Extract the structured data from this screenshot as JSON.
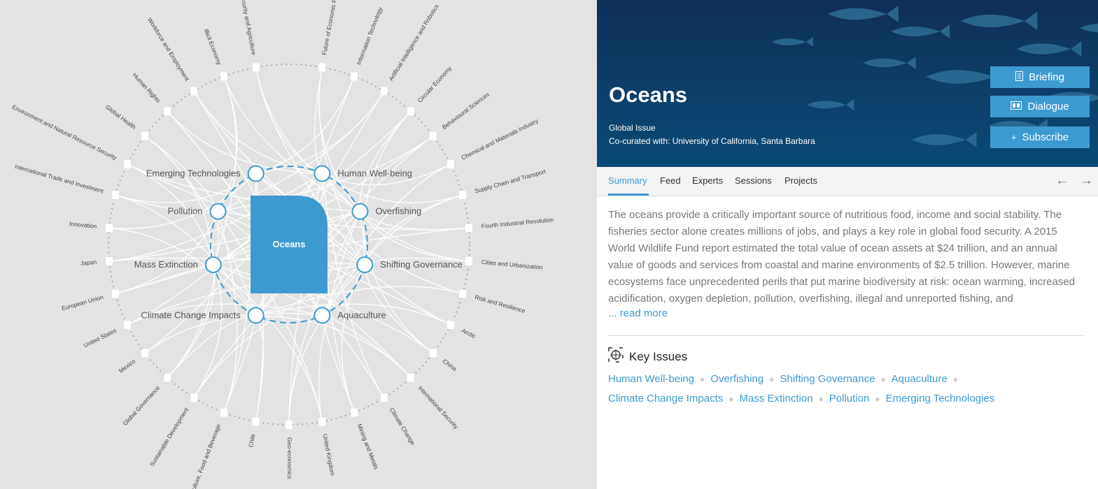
{
  "graph": {
    "center_label": "Oceans",
    "key_issues": [
      "Human Well-being",
      "Overfishing",
      "Shifting Governance",
      "Aquaculture",
      "Climate Change Impacts",
      "Mass Extinction",
      "Pollution",
      "Emerging Technologies"
    ],
    "outer_topics": [
      "Food Security and Agriculture",
      "Illicit Economy",
      "Workforce and Employment",
      "Human Rights",
      "Global Health",
      "Environment and Natural Resource Security",
      "International Trade and Investment",
      "Innovation",
      "Japan",
      "European Union",
      "United States",
      "Mexico",
      "Global Governance",
      "Sustainable Development",
      "Agriculture, Food and Beverage",
      "Chile",
      "Geo-economics",
      "United Kingdom",
      "Mining and Metals",
      "Climate Change",
      "International Security",
      "China",
      "Arctic",
      "Risk and Resilience",
      "Cities and Urbanization",
      "Fourth Industrial Revolution",
      "Supply Chain and Transport",
      "Chemical and Materials Industry",
      "Behavioural Sciences",
      "Circular Economy",
      "Artificial Intelligence and Robotics",
      "Information Technology",
      "Future of Economic Progress"
    ],
    "colors": {
      "accent": "#3d9ad1",
      "background": "#e3e3e3",
      "links": "#ffffff",
      "ring": "#aaaaaa"
    }
  },
  "hero": {
    "title": "Oceans",
    "type": "Global Issue",
    "cocurated": "Co-curated with: University of California, Santa Barbara",
    "buttons": {
      "briefing": "Briefing",
      "dialogue": "Dialogue",
      "subscribe": "Subscribe"
    }
  },
  "tabs": [
    "Summary",
    "Feed",
    "Experts",
    "Sessions",
    "Projects"
  ],
  "summary": {
    "text": "The oceans provide a critically important source of nutritious food, income and social stability. The fisheries sector alone creates millions of jobs, and plays a key role in global food security. A 2015 World Wildlife Fund report estimated the total value of ocean assets at $24 trillion, and an annual value of goods and services from coastal and marine environments of $2.5 trillion. However, marine ecosystems face unprecedented perils that put marine biodiversity at risk: ocean warming, increased acidification, oxygen depletion, pollution, overfishing, illegal and unreported fishing, and",
    "read_more": "... read more"
  },
  "key_issues": {
    "heading": "Key Issues",
    "row1": [
      "Human Well-being",
      "Overfishing",
      "Shifting Governance",
      "Aquaculture"
    ],
    "row2": [
      "Climate Change Impacts",
      "Mass Extinction",
      "Pollution",
      "Emerging Technologies"
    ]
  }
}
